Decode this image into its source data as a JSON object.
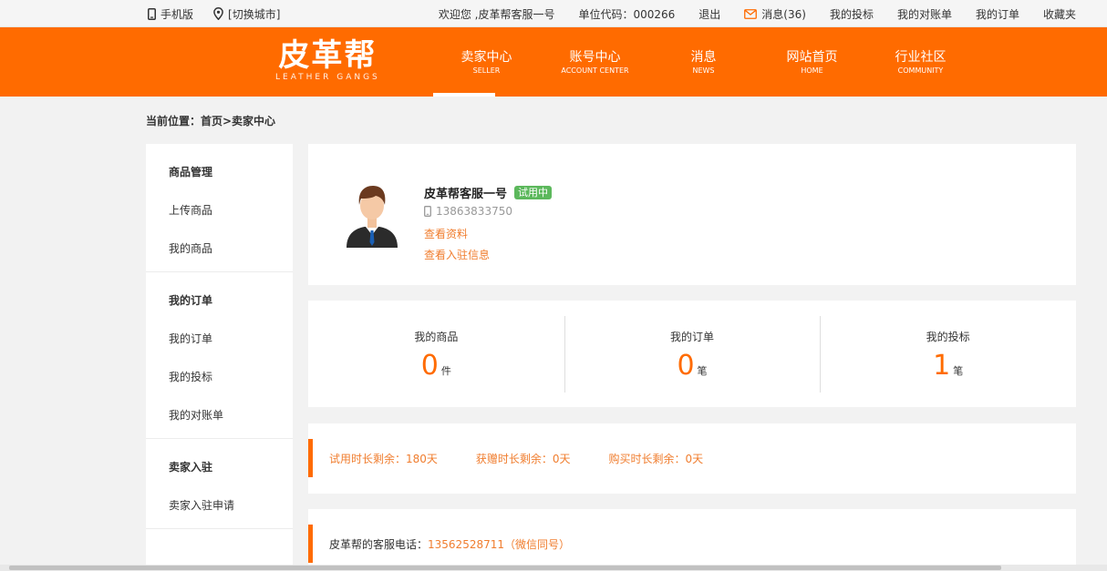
{
  "topbar": {
    "mobile": "手机版",
    "city": "[切换城市]",
    "welcome": "欢迎您 ,皮革帮客服一号",
    "unit_code": "单位代码：000266",
    "logout": "退出",
    "messages": "消息(36)",
    "my_bids": "我的投标",
    "my_statements": "我的对账单",
    "my_orders": "我的订单",
    "favorites": "收藏夹"
  },
  "header": {
    "logo_cn": "皮革帮",
    "logo_en": "LEATHER GANGS",
    "nav": [
      {
        "cn": "卖家中心",
        "en": "SELLER"
      },
      {
        "cn": "账号中心",
        "en": "ACCOUNT CENTER"
      },
      {
        "cn": "消息",
        "en": "NEWS"
      },
      {
        "cn": "网站首页",
        "en": "HOME"
      },
      {
        "cn": "行业社区",
        "en": "COMMUNITY"
      }
    ]
  },
  "breadcrumb": "当前位置：首页>卖家中心",
  "sidebar": {
    "groups": [
      {
        "title": "商品管理",
        "links": [
          "上传商品",
          "我的商品"
        ]
      },
      {
        "title": "我的订单",
        "links": [
          "我的订单",
          "我的投标",
          "我的对账单"
        ]
      },
      {
        "title": "卖家入驻",
        "links": [
          "卖家入驻申请"
        ]
      }
    ]
  },
  "profile": {
    "name": "皮革帮客服一号",
    "badge": "试用中",
    "phone": "13863833750",
    "view_profile": "查看资料",
    "view_settle": "查看入驻信息"
  },
  "stats": [
    {
      "label": "我的商品",
      "value": "0",
      "unit": "件"
    },
    {
      "label": "我的订单",
      "value": "0",
      "unit": "笔"
    },
    {
      "label": "我的投标",
      "value": "1",
      "unit": "笔"
    }
  ],
  "remaining": {
    "trial": "试用时长剩余：180天",
    "gift": "获赠时长剩余：0天",
    "bought": "购买时长剩余：0天"
  },
  "service": {
    "label": "皮革帮的客服电话：",
    "phone": "13562528711（微信同号）"
  },
  "colors": {
    "brand": "#ff6b00",
    "link": "#f07d2e",
    "badge": "#5cb85c"
  }
}
